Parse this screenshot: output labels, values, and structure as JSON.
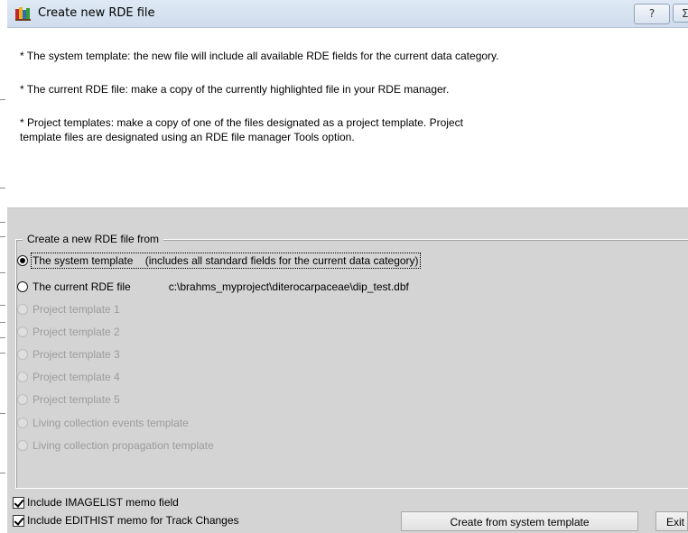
{
  "window": {
    "title": "Create new RDE file",
    "help_label": "?",
    "close_label": "Σ",
    "icon": "rde-app-icon"
  },
  "info": {
    "line1": "* The system template: the new file will include all available RDE fields for the current data category.",
    "line2": "* The current RDE file: make a copy of the currently highlighted file in your RDE manager.",
    "line3a": "* Project templates: make a copy of one of the files designated as a project template. Project",
    "line3b": "template files are designated using an RDE file manager Tools option."
  },
  "group": {
    "legend": "Create a new RDE file from",
    "options": [
      {
        "label": "The system template    (includes all standard fields for the current data category)",
        "checked": true,
        "enabled": true
      },
      {
        "label": "The current RDE file",
        "path": "c:\\brahms_myproject\\diterocarpaceae\\dip_test.dbf",
        "checked": false,
        "enabled": true
      },
      {
        "label": "Project template 1",
        "checked": false,
        "enabled": false
      },
      {
        "label": "Project template 2",
        "checked": false,
        "enabled": false
      },
      {
        "label": "Project template 3",
        "checked": false,
        "enabled": false
      },
      {
        "label": "Project template 4",
        "checked": false,
        "enabled": false
      },
      {
        "label": "Project template 5",
        "checked": false,
        "enabled": false
      },
      {
        "label": "Living collection events template",
        "checked": false,
        "enabled": false
      },
      {
        "label": "Living collection propagation template",
        "checked": false,
        "enabled": false
      }
    ]
  },
  "checkboxes": {
    "imagelist": {
      "label": "Include IMAGELIST memo field",
      "checked": true
    },
    "edithist": {
      "label": "Include EDITHIST memo for Track Changes",
      "checked": true
    }
  },
  "buttons": {
    "create": "Create from system template",
    "exit": "Exit"
  }
}
